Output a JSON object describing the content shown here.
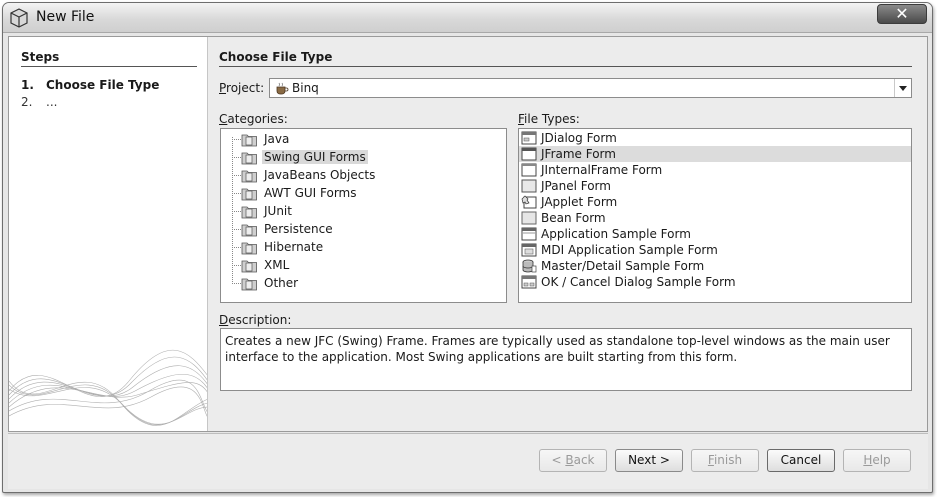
{
  "window": {
    "title": "New File",
    "close_label": "✕"
  },
  "steps": {
    "heading": "Steps",
    "items": [
      {
        "num": "1.",
        "label": "Choose File Type"
      },
      {
        "num": "2.",
        "label": "..."
      }
    ]
  },
  "main": {
    "heading": "Choose File Type",
    "project": {
      "label_prefix": "P",
      "label_rest": "roject:",
      "value": "Binq",
      "icon": "coffee-cup-icon"
    },
    "categories": {
      "label_prefix": "C",
      "label_rest": "ategories:",
      "selected": "Swing GUI Forms",
      "items": [
        {
          "label": "Java"
        },
        {
          "label": "Swing GUI Forms"
        },
        {
          "label": "JavaBeans Objects"
        },
        {
          "label": "AWT GUI Forms"
        },
        {
          "label": "JUnit"
        },
        {
          "label": "Persistence"
        },
        {
          "label": "Hibernate"
        },
        {
          "label": "XML"
        },
        {
          "label": "Other"
        }
      ]
    },
    "file_types": {
      "label_prefix": "F",
      "label_rest": "ile Types:",
      "selected": "JFrame Form",
      "items": [
        {
          "label": "JDialog Form",
          "icon": "dialog-form-icon"
        },
        {
          "label": "JFrame Form",
          "icon": "frame-form-icon"
        },
        {
          "label": "JInternalFrame Form",
          "icon": "internal-frame-icon"
        },
        {
          "label": "JPanel Form",
          "icon": "panel-form-icon"
        },
        {
          "label": "JApplet Form",
          "icon": "applet-form-icon"
        },
        {
          "label": "Bean Form",
          "icon": "bean-form-icon"
        },
        {
          "label": "Application Sample Form",
          "icon": "application-form-icon"
        },
        {
          "label": "MDI Application Sample Form",
          "icon": "mdi-form-icon"
        },
        {
          "label": "Master/Detail Sample Form",
          "icon": "database-form-icon"
        },
        {
          "label": "OK / Cancel Dialog Sample Form",
          "icon": "ok-cancel-dialog-icon"
        }
      ]
    },
    "description": {
      "label_prefix": "D",
      "label_rest": "escription:",
      "text": "Creates a new JFC (Swing) Frame. Frames are typically used as standalone top-level windows as the main user interface to the application. Most Swing applications are built starting from this form."
    }
  },
  "buttons": {
    "back": {
      "prefix": "< ",
      "mnemonic": "B",
      "rest": "ack",
      "enabled": false
    },
    "next": {
      "label": "Next >",
      "enabled": true
    },
    "finish": {
      "mnemonic": "F",
      "rest": "inish",
      "enabled": false
    },
    "cancel": {
      "label": "Cancel",
      "enabled": true
    },
    "help": {
      "mnemonic": "H",
      "rest": "elp",
      "enabled": false
    }
  }
}
